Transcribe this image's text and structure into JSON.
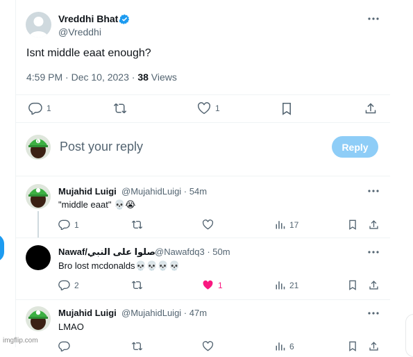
{
  "tweet": {
    "author_name": "Vreddhi Bhat",
    "author_handle": "@Vreddhi",
    "text": "Isnt middle eaat enough?",
    "timestamp": "4:59 PM · Dec 10, 2023 · ",
    "views_count": "38",
    "views_label": " Views",
    "replies": "1",
    "likes": "1"
  },
  "composer": {
    "placeholder": "Post your reply",
    "reply_button": "Reply"
  },
  "replies": [
    {
      "name": "Mujahid Luigi",
      "handle_time": "@MujahidLuigi · 54m",
      "text": "\"middle eaat\" 💀😭",
      "replies": "1",
      "likes": "",
      "views": "17"
    },
    {
      "name": "Nawaf/صلوا على النبي",
      "handle_time": "@Nawafdq3 · 50m",
      "text": "Bro lost mcdonalds💀💀💀💀",
      "replies": "2",
      "likes": "1",
      "views": "21"
    },
    {
      "name": "Mujahid Luigi",
      "handle_time": "@MujahidLuigi · 47m",
      "text": "LMAO",
      "replies": "",
      "likes": "",
      "views": "6"
    }
  ],
  "watermark": "imgflip.com",
  "colors": {
    "accent": "#1d9bf0",
    "like_active": "#f91880",
    "muted": "#536471"
  }
}
